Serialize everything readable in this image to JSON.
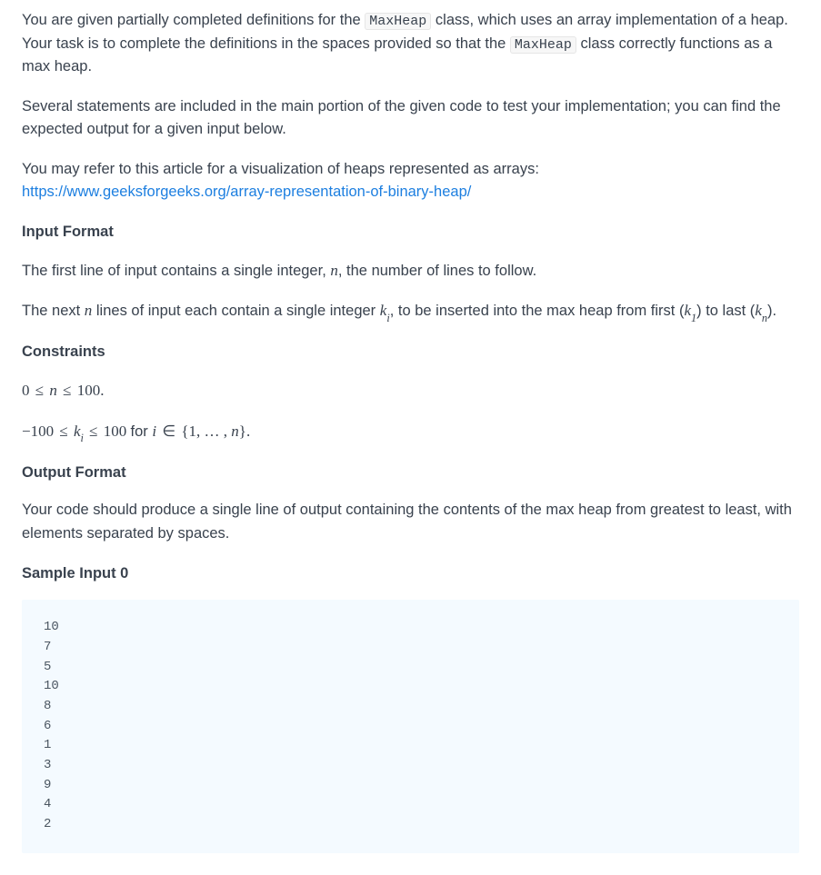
{
  "intro": {
    "p1_a": "You are given partially completed definitions for the ",
    "p1_code1": "MaxHeap",
    "p1_b": " class, which uses an array implementation of a heap. Your task is to complete the definitions in the spaces provided so that the ",
    "p1_code2": "MaxHeap",
    "p1_c": " class correctly functions as a max heap.",
    "p2": "Several statements are included in the main portion of the given code to test your implementation; you can find the expected output for a given input below.",
    "p3_a": "You may refer to this article for a visualization of heaps represented as arrays:",
    "p3_link": "https://www.geeksforgeeks.org/array-representation-of-binary-heap/"
  },
  "input_format": {
    "heading": "Input Format",
    "p1_a": "The first line of input contains a single integer, ",
    "p1_var": "n",
    "p1_b": ", the number of lines to follow.",
    "p2_a": "The next ",
    "p2_var_n": "n",
    "p2_b": " lines of input each contain a single integer ",
    "p2_var_ki": "k",
    "p2_sub_i": "i",
    "p2_c": ", to be inserted into the max heap from first (",
    "p2_var_k1": "k",
    "p2_sub_1": "1",
    "p2_d": ") to last (",
    "p2_var_kn": "k",
    "p2_sub_n": "n",
    "p2_e": ")."
  },
  "constraints": {
    "heading": "Constraints",
    "line1": {
      "a": "0",
      "op1": "≤",
      "b": "n",
      "op2": "≤",
      "c": "100",
      "end": "."
    },
    "line2": {
      "a": "−100",
      "op1": "≤",
      "b": "k",
      "bsub": "i",
      "op2": "≤",
      "c": "100",
      "for": " for ",
      "ivar": "i",
      "in": " ∈ ",
      "set_a": "{1, … , ",
      "nvar": "n",
      "set_b": "}",
      "end": "."
    }
  },
  "output_format": {
    "heading": "Output Format",
    "p1": "Your code should produce a single line of output containing the contents of the max heap from greatest to least, with elements separated by spaces."
  },
  "sample": {
    "heading": "Sample Input 0",
    "lines": [
      "10",
      "7",
      "5",
      "10",
      "8",
      "6",
      "1",
      "3",
      "9",
      "4",
      "2"
    ]
  }
}
